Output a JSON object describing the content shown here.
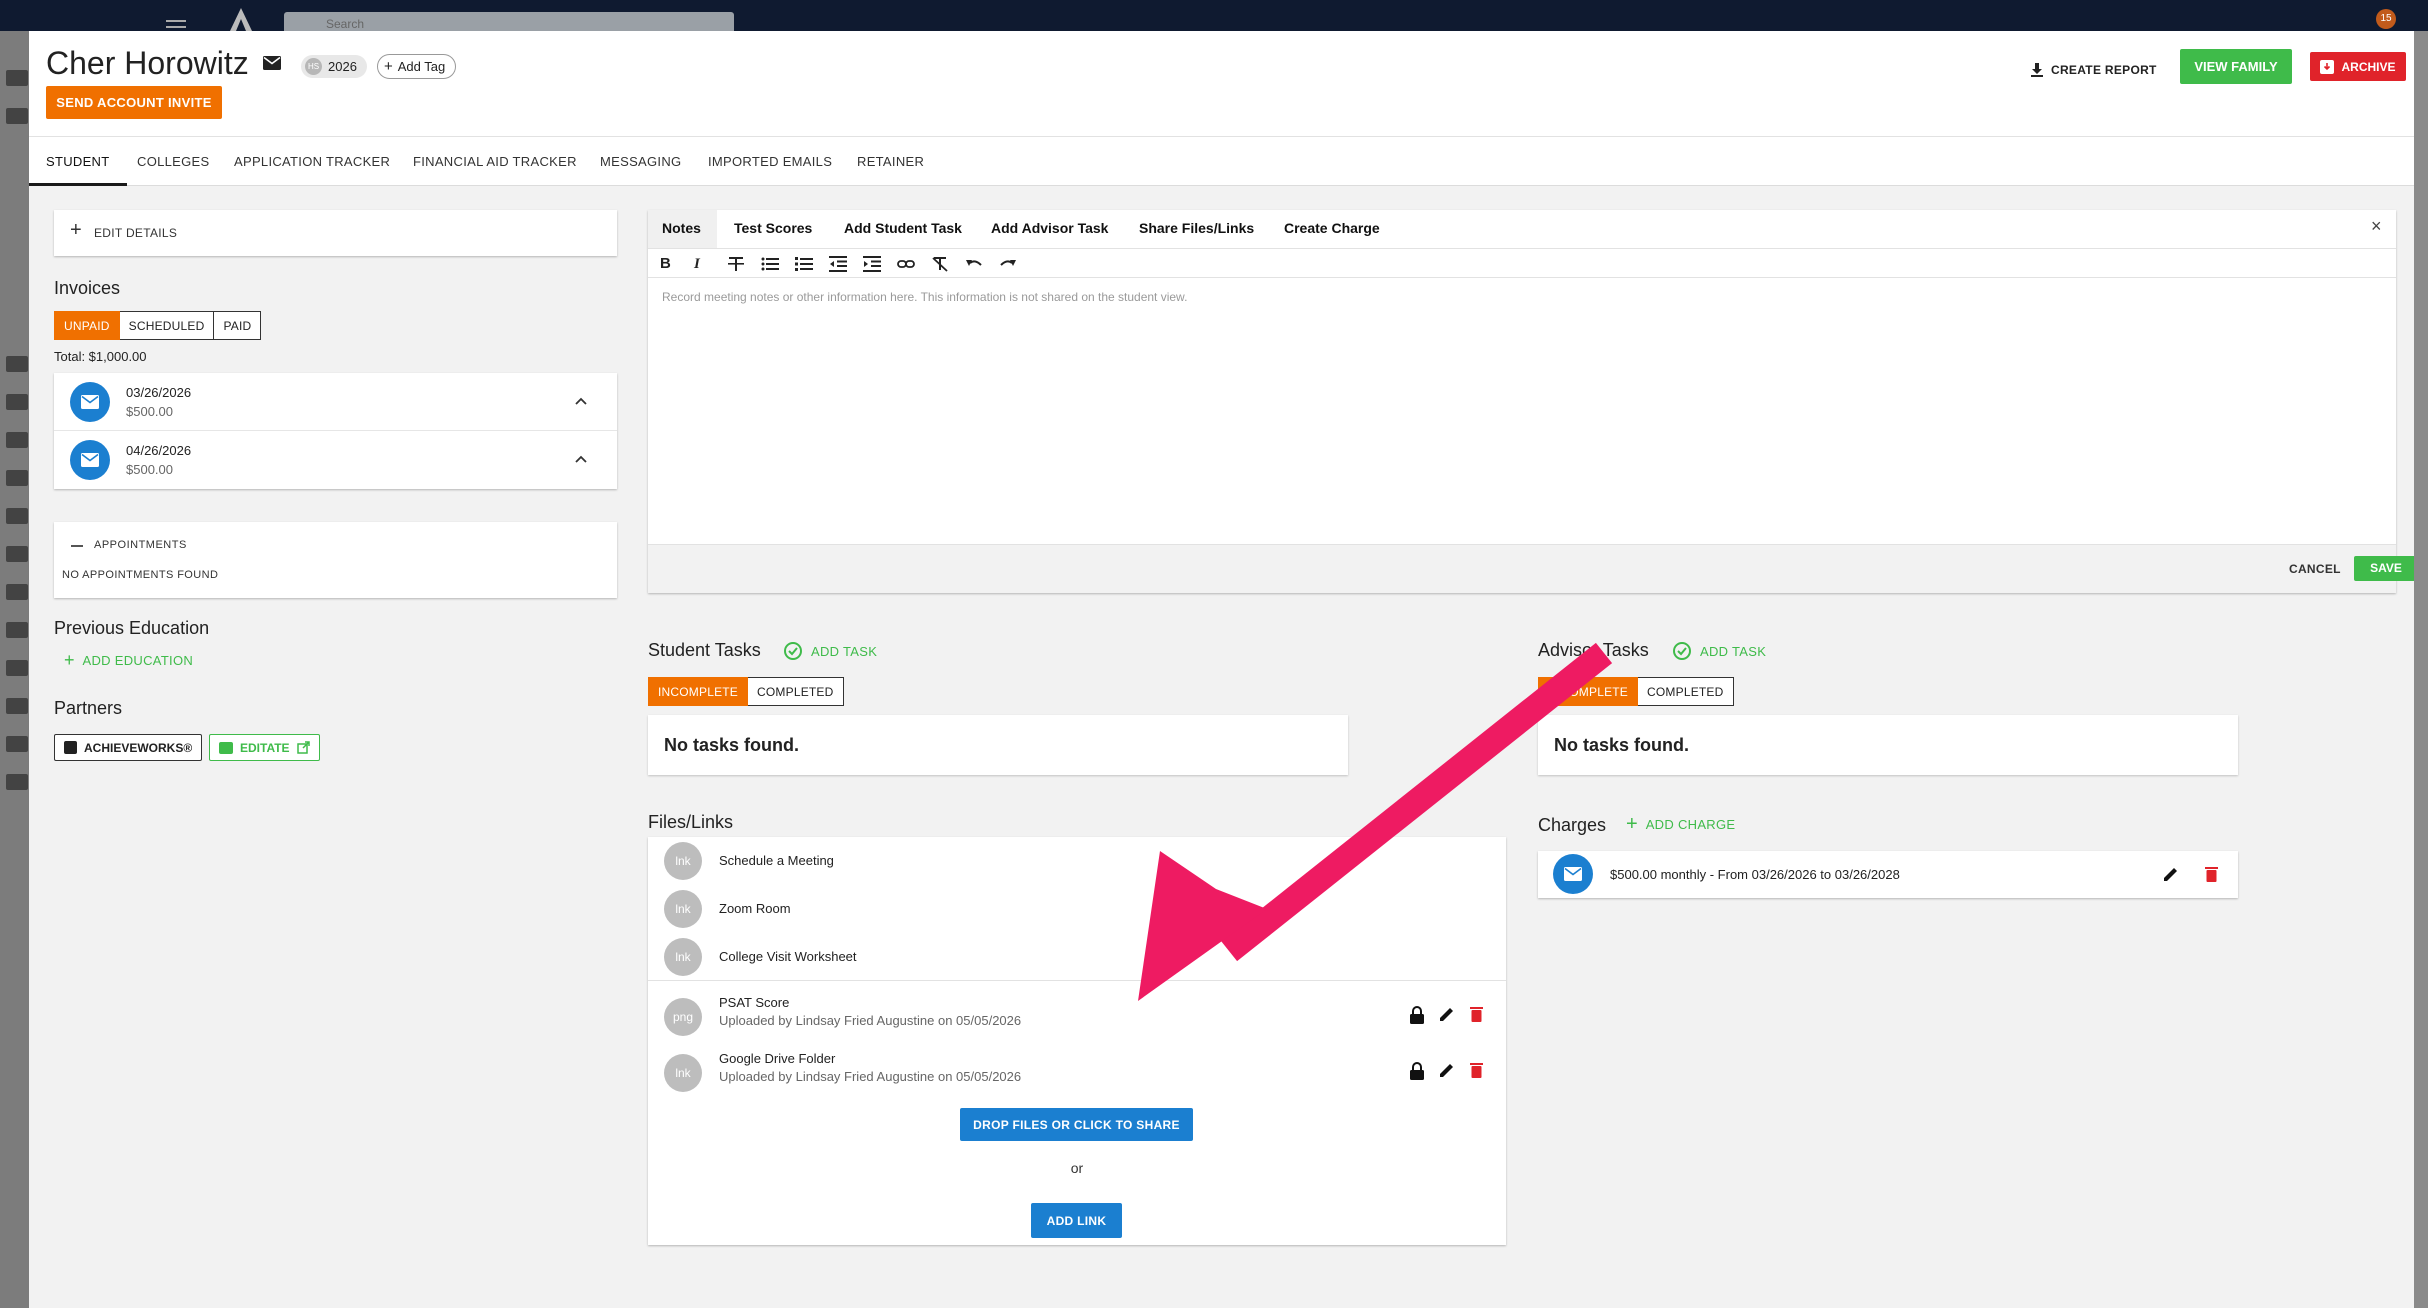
{
  "background": {
    "search_placeholder": "Search",
    "notification_count": "15"
  },
  "header": {
    "student_name": "Cher Horowitz",
    "grade_chip_prefix": "HS",
    "grade_year": "2026",
    "add_tag_label": "Add Tag",
    "send_invite_label": "SEND ACCOUNT INVITE",
    "create_report_label": "CREATE REPORT",
    "view_family_label": "VIEW FAMILY",
    "archive_label": "ARCHIVE"
  },
  "tabs": [
    {
      "label": "STUDENT",
      "active": true
    },
    {
      "label": "COLLEGES"
    },
    {
      "label": "APPLICATION TRACKER"
    },
    {
      "label": "FINANCIAL AID TRACKER"
    },
    {
      "label": "MESSAGING"
    },
    {
      "label": "IMPORTED EMAILS"
    },
    {
      "label": "RETAINER"
    }
  ],
  "left": {
    "edit_details_label": "EDIT DETAILS",
    "invoices": {
      "title": "Invoices",
      "filters": [
        "UNPAID",
        "SCHEDULED",
        "PAID"
      ],
      "total_text": "Total: $1,000.00",
      "items": [
        {
          "date": "03/26/2026",
          "amount": "$500.00"
        },
        {
          "date": "04/26/2026",
          "amount": "$500.00"
        }
      ]
    },
    "appointments": {
      "label": "APPOINTMENTS",
      "empty_text": "NO APPOINTMENTS FOUND"
    },
    "previous_education": {
      "title": "Previous Education",
      "add_label": "ADD EDUCATION"
    },
    "partners": {
      "title": "Partners",
      "achieveworks_label": "ACHIEVEWORKS®",
      "editate_label": "EDITATE"
    }
  },
  "editor": {
    "tabs": [
      "Notes",
      "Test Scores",
      "Add Student Task",
      "Add Advisor Task",
      "Share Files/Links",
      "Create Charge"
    ],
    "active_tab": "Notes",
    "placeholder": "Record meeting notes or other information here. This information is not shared on the student view.",
    "cancel_label": "CANCEL",
    "save_label": "SAVE"
  },
  "student_tasks": {
    "title": "Student Tasks",
    "add_label": "ADD TASK",
    "filters": [
      "INCOMPLETE",
      "COMPLETED"
    ],
    "empty_text": "No tasks found."
  },
  "advisor_tasks": {
    "title": "Advisor Tasks",
    "add_label": "ADD TASK",
    "filters": [
      "INCOMPLETE",
      "COMPLETED"
    ],
    "empty_text": "No tasks found."
  },
  "files": {
    "title": "Files/Links",
    "default_links": [
      {
        "type": "lnk",
        "name": "Schedule a Meeting"
      },
      {
        "type": "lnk",
        "name": "Zoom Room"
      },
      {
        "type": "lnk",
        "name": "College Visit Worksheet"
      }
    ],
    "uploaded": [
      {
        "type": "png",
        "name": "PSAT Score",
        "meta": "Uploaded by Lindsay Fried Augustine on 05/05/2026"
      },
      {
        "type": "lnk",
        "name": "Google Drive Folder",
        "meta": "Uploaded by Lindsay Fried Augustine on 05/05/2026"
      }
    ],
    "share_label": "DROP FILES OR CLICK TO SHARE",
    "or_label": "or",
    "add_link_label": "ADD LINK"
  },
  "charges": {
    "title": "Charges",
    "add_label": "ADD CHARGE",
    "items": [
      {
        "text": "$500.00 monthly - From 03/26/2026 to 03/26/2028"
      }
    ]
  },
  "colors": {
    "orange": "#f07000",
    "green": "#3fbb4a",
    "blue": "#1b7fd0",
    "red": "#e0232a",
    "annotation_arrow": "#ee1b62"
  }
}
